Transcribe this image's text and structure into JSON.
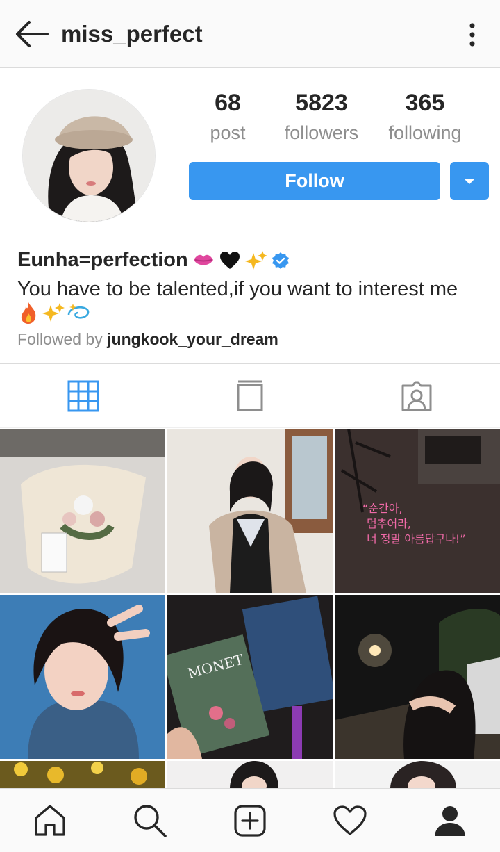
{
  "header": {
    "username": "miss_perfect",
    "back_icon": "arrow-left-icon",
    "more_icon": "vertical-dots-icon"
  },
  "profile": {
    "stats": [
      {
        "value": "68",
        "label": "post"
      },
      {
        "value": "5823",
        "label": "followers"
      },
      {
        "value": "365",
        "label": "following"
      }
    ],
    "follow_label": "Follow",
    "accent_color": "#3897f0",
    "display_name": "Eunha=perfection",
    "bio": "You have  to be talented,if you want to  interest me",
    "followed_by_prefix": "Followed by",
    "followed_by_user": "jungkook_your_dream"
  },
  "tabs": [
    {
      "name": "grid",
      "icon": "grid-icon",
      "active": true
    },
    {
      "name": "igtv",
      "icon": "book-icon",
      "active": false
    },
    {
      "name": "tagged",
      "icon": "tagged-person-icon",
      "active": false
    }
  ],
  "grid_posts": [
    {
      "desc": "flower bouquet"
    },
    {
      "desc": "girl in coat"
    },
    {
      "desc": "neon sign"
    },
    {
      "desc": "peace sign selfie"
    },
    {
      "desc": "art books"
    },
    {
      "desc": "night street hug"
    },
    {
      "desc": "yellow flowers"
    },
    {
      "desc": "portrait"
    },
    {
      "desc": "portrait"
    }
  ],
  "bottom_nav": [
    {
      "name": "home",
      "icon": "home-icon"
    },
    {
      "name": "search",
      "icon": "search-icon"
    },
    {
      "name": "new-post",
      "icon": "plus-square-icon"
    },
    {
      "name": "activity",
      "icon": "heart-icon"
    },
    {
      "name": "profile",
      "icon": "profile-icon"
    }
  ]
}
